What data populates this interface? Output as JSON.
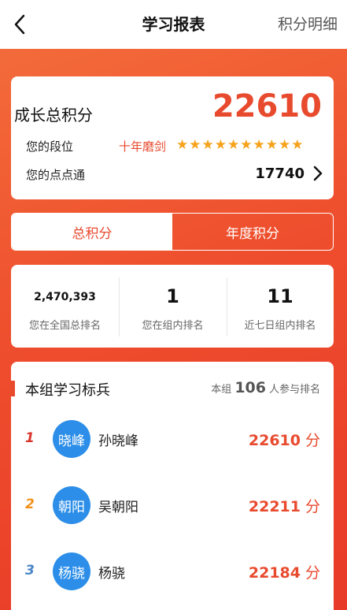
{
  "header": {
    "title": "学习报表",
    "detail_link": "积分明细"
  },
  "score": {
    "label": "成长总积分",
    "value": "22610",
    "rank_label": "您的段位",
    "rank_name": "十年磨剑",
    "stars": 10,
    "points_label": "您的点点通",
    "points_value": "17740"
  },
  "tabs": [
    {
      "label": "总积分",
      "active": true
    },
    {
      "label": "年度积分",
      "active": false
    }
  ],
  "stats": [
    {
      "value": "2,470,393",
      "label": "您在全国总排名"
    },
    {
      "value": "1",
      "label": "您在组内排名"
    },
    {
      "value": "11",
      "label": "近七日组内排名"
    }
  ],
  "board": {
    "title": "本组学习标兵",
    "count_prefix": "本组",
    "count": "106",
    "count_suffix": "人参与排名",
    "score_unit": "分",
    "rows": [
      {
        "rank": "1",
        "avatar": "晓峰",
        "name": "孙晓峰",
        "score": "22610",
        "rank_color": "#d9342b"
      },
      {
        "rank": "2",
        "avatar": "朝阳",
        "name": "吴朝阳",
        "score": "22211",
        "rank_color": "#f0921c"
      },
      {
        "rank": "3",
        "avatar": "杨骁",
        "name": "杨骁",
        "score": "22184",
        "rank_color": "#4a86c8"
      }
    ]
  },
  "colors": {
    "accent": "#e84a2e",
    "avatar_bg": "#2c8ee8",
    "star": "#f6a21a"
  }
}
